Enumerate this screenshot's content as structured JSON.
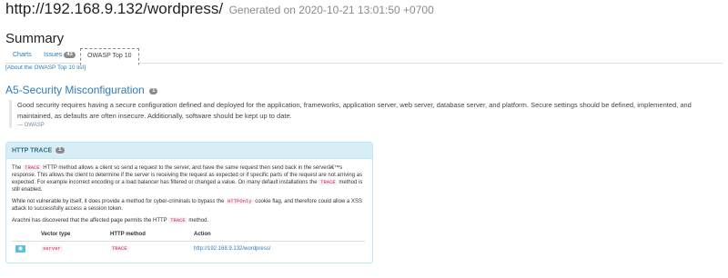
{
  "header": {
    "url": "http://192.168.9.132/wordpress/",
    "generated": "Generated on 2020-10-21 13:01:50 +0700"
  },
  "summary": {
    "title": "Summary"
  },
  "tabs": [
    {
      "label": "Charts"
    },
    {
      "label": "Issues",
      "badge": "43"
    },
    {
      "label": "OWASP Top 10",
      "active": true
    }
  ],
  "about_link": "[About the OWASP Top 10 list]",
  "section": {
    "title": "A5-Security Misconfiguration",
    "count": "1",
    "quote": "Good security requires having a secure configuration defined and deployed for the application, frameworks, application server, web server, database server, and platform. Secure settings should be defined, implemented, and maintained, as defaults are often insecure. Additionally, software should be kept up to date.",
    "quote_source": "— OWASP"
  },
  "issue": {
    "title": "HTTP TRACE",
    "count": "1",
    "p1_a": "The",
    "p1_code": "TRACE",
    "p1_b": "HTTP method allows a client so send a request to the server, and have the same request then send back in the serverâ€™s response. This allows the client to determine if the server is receiving the request as expected or if specific parts of the request are not arriving as expected. For example incorrect encoding or a load balancer has filtered or changed a value. On many default installations the",
    "p1_code2": "TRACE",
    "p1_c": "method is still enabled.",
    "p2_a": "While not vulnerable by itself, it does provide a method for cyber-criminals to bypass the",
    "p2_code": "HTTPOnly",
    "p2_b": "cookie flag, and therefore could allow a XSS attack to successfully access a session token.",
    "p3_a": "Arachni has discovered that the affected page permits the HTTP",
    "p3_code": "TRACE",
    "p3_b": "method.",
    "table": {
      "headers": [
        "Vector type",
        "HTTP method",
        "Action"
      ],
      "rows": [
        {
          "vector": "server",
          "method": "TRACE",
          "action": "http://192.168.9.132/wordpress/"
        }
      ]
    }
  },
  "colors": {
    "link": "#2f7bb8",
    "panel_head_bg": "#d9edf7",
    "code": "#c7254e",
    "view_button": "#5bc0de"
  },
  "icons": {
    "view_button": "eye-icon"
  }
}
